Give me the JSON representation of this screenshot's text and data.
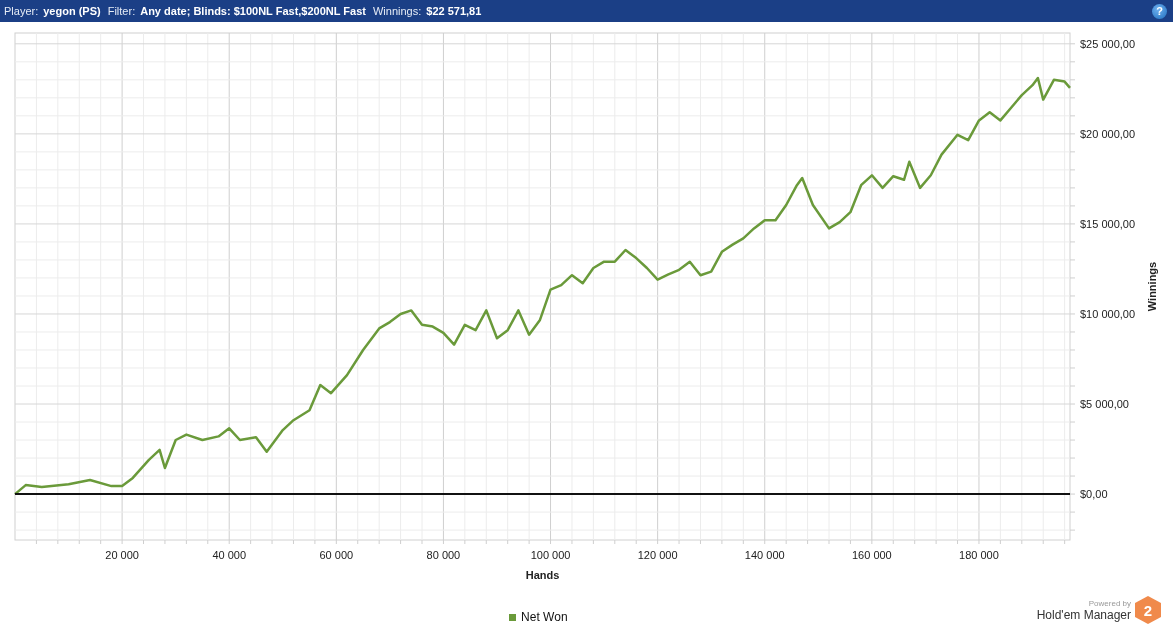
{
  "header": {
    "items": [
      {
        "label": "Player:",
        "value": "yegon (PS)"
      },
      {
        "label": "Filter:",
        "value": "Any date; Blinds: $100NL Fast,$200NL Fast"
      },
      {
        "label": "Winnings:",
        "value": "$22 571,81"
      }
    ],
    "help_button": "?"
  },
  "chart_data": {
    "type": "line",
    "grid": true,
    "xlabel": "Hands",
    "ylabel": "Winnings",
    "x": [
      0,
      2000,
      5000,
      10000,
      14000,
      18000,
      20000,
      22000,
      25000,
      27000,
      28000,
      30000,
      32000,
      35000,
      38000,
      40000,
      42000,
      45000,
      47000,
      50000,
      52000,
      55000,
      57000,
      59000,
      62000,
      65000,
      68000,
      70000,
      72000,
      74000,
      76000,
      78000,
      80000,
      82000,
      84000,
      86000,
      88000,
      90000,
      92000,
      94000,
      96000,
      98000,
      100000,
      102000,
      104000,
      106000,
      108000,
      110000,
      112000,
      114000,
      116000,
      118000,
      120000,
      122000,
      124000,
      126000,
      128000,
      130000,
      132000,
      134000,
      136000,
      138000,
      140000,
      142000,
      144000,
      146000,
      147000,
      149000,
      152000,
      154000,
      156000,
      158000,
      160000,
      162000,
      164000,
      166000,
      167000,
      169000,
      171000,
      173000,
      176000,
      178000,
      180000,
      182000,
      184000,
      186000,
      188000,
      190000,
      191000,
      192000,
      194000,
      196000,
      197000
    ],
    "series": [
      {
        "name": "Net Won",
        "color": "#6a9a3a",
        "values": [
          0,
          500,
          400,
          550,
          780,
          440,
          440,
          900,
          1900,
          2450,
          1450,
          3000,
          3300,
          3000,
          3200,
          3650,
          3000,
          3150,
          2350,
          3550,
          4100,
          4650,
          6050,
          5600,
          6600,
          8000,
          9200,
          9550,
          10000,
          10200,
          9400,
          9300,
          8950,
          8300,
          9400,
          9100,
          10200,
          8650,
          9100,
          10200,
          8850,
          9650,
          11350,
          11600,
          12150,
          11700,
          12550,
          12900,
          12900,
          13550,
          13100,
          12550,
          11900,
          12200,
          12450,
          12900,
          12150,
          12350,
          13450,
          13850,
          14200,
          14750,
          15200,
          15200,
          16050,
          17150,
          17550,
          16050,
          14750,
          15100,
          15650,
          17150,
          17700,
          17000,
          17650,
          17450,
          18450,
          17000,
          17700,
          18850,
          19950,
          19650,
          20750,
          21200,
          20750,
          21450,
          22150,
          22700,
          23100,
          21900,
          23000,
          22900,
          22550
        ]
      }
    ],
    "xlim": [
      0,
      197000
    ],
    "ylim": [
      -2550,
      25600
    ],
    "xticks": [
      {
        "value": 20000,
        "label": "20 000"
      },
      {
        "value": 40000,
        "label": "40 000"
      },
      {
        "value": 60000,
        "label": "60 000"
      },
      {
        "value": 80000,
        "label": "80 000"
      },
      {
        "value": 100000,
        "label": "100 000"
      },
      {
        "value": 120000,
        "label": "120 000"
      },
      {
        "value": 140000,
        "label": "140 000"
      },
      {
        "value": 160000,
        "label": "160 000"
      },
      {
        "value": 180000,
        "label": "180 000"
      }
    ],
    "yticks": [
      {
        "value": 0,
        "label": "$0,00"
      },
      {
        "value": 5000,
        "label": "$5 000,00"
      },
      {
        "value": 10000,
        "label": "$10 000,00"
      },
      {
        "value": 15000,
        "label": "$15 000,00"
      },
      {
        "value": 20000,
        "label": "$20 000,00"
      },
      {
        "value": 25000,
        "label": "$25 000,00"
      }
    ]
  },
  "branding": {
    "powered_by": "Powered by",
    "product": "Hold'em Manager",
    "logo_text": "2"
  }
}
